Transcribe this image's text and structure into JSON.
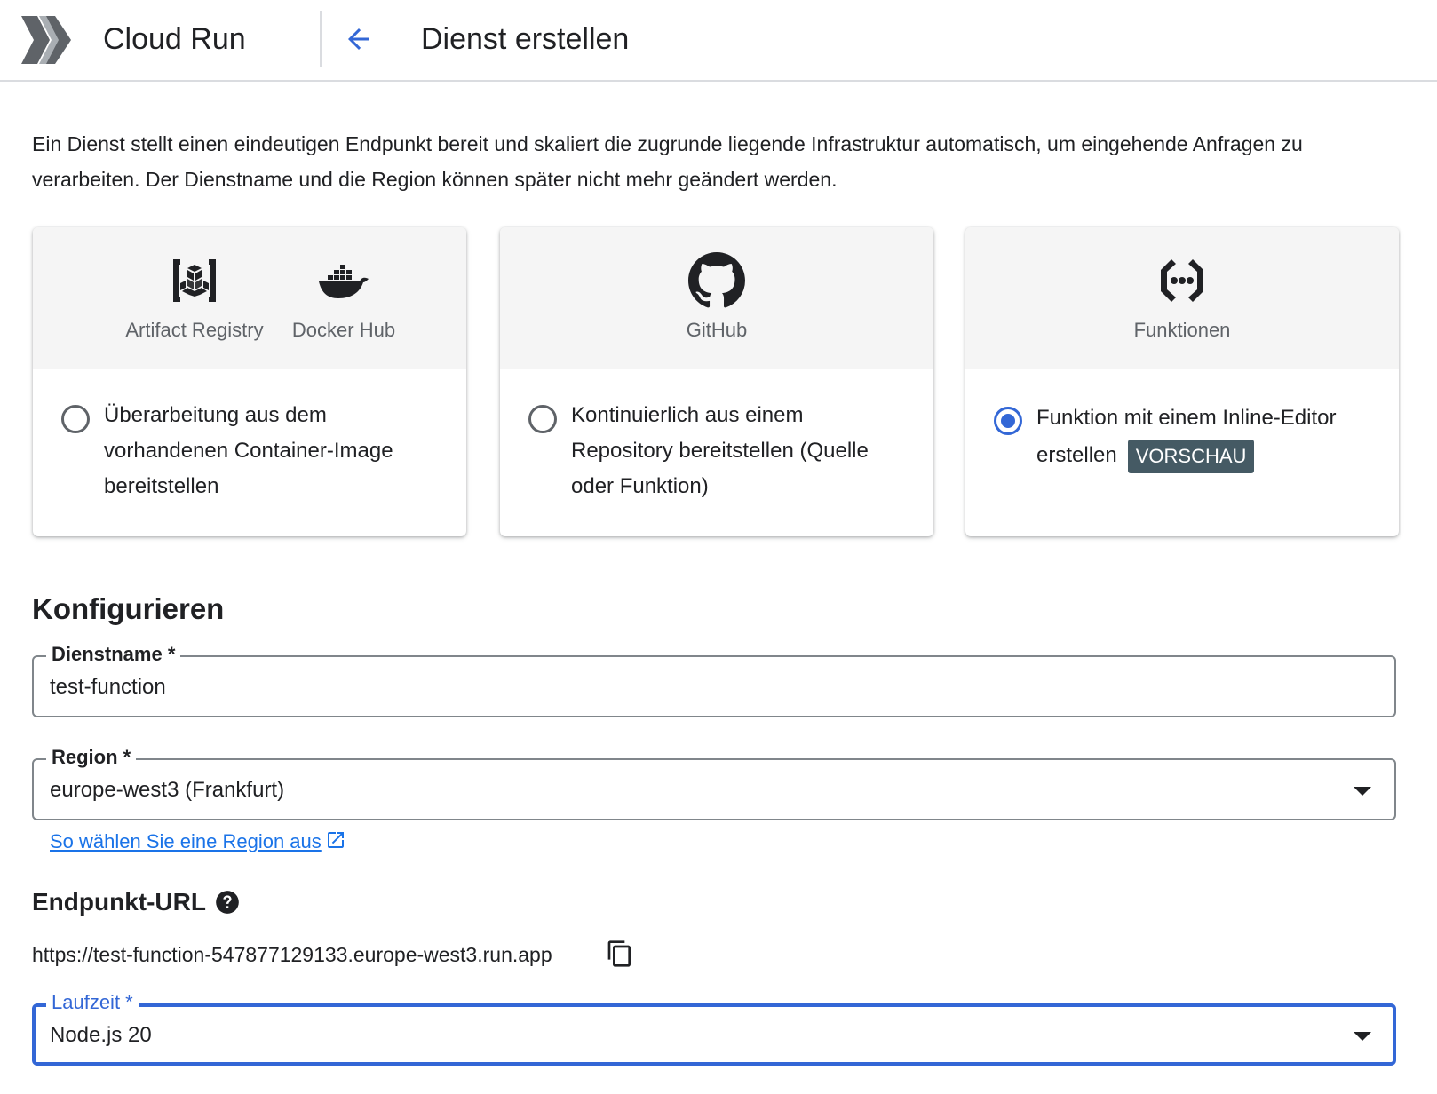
{
  "header": {
    "product_name": "Cloud Run",
    "page_title": "Dienst erstellen",
    "logo_icon": "cloud-run-logo",
    "back_icon": "arrow-back-icon"
  },
  "intro": {
    "text": "Ein Dienst stellt einen eindeutigen Endpunkt bereit und skaliert die zugrunde liegende Infrastruktur automatisch, um eingehende Anfragen zu verarbeiten. Der Dienstname und die Region können später nicht mehr geändert werden."
  },
  "deploy_options": [
    {
      "sources": [
        {
          "label": "Artifact Registry",
          "icon": "artifact-registry-icon"
        },
        {
          "label": "Docker Hub",
          "icon": "docker-icon"
        }
      ],
      "text": "Überarbeitung aus dem vorhandenen Container-Image bereitstellen",
      "selected": false
    },
    {
      "sources": [
        {
          "label": "GitHub",
          "icon": "github-icon"
        }
      ],
      "text": "Kontinuierlich aus einem Repository bereitstellen (Quelle oder Funktion)",
      "selected": false
    },
    {
      "sources": [
        {
          "label": "Funktionen",
          "icon": "functions-icon"
        }
      ],
      "text": "Funktion mit einem Inline-Editor erstellen",
      "badge": "VORSCHAU",
      "selected": true
    }
  ],
  "configure": {
    "title": "Konfigurieren",
    "service_name": {
      "label": "Dienstname *",
      "value": "test-function"
    },
    "region": {
      "label": "Region *",
      "value": "europe-west3 (Frankfurt)"
    },
    "region_help_link": "So wählen Sie eine Region aus",
    "endpoint": {
      "title": "Endpunkt-URL",
      "url": "https://test-function-547877129133.europe-west3.run.app"
    },
    "runtime": {
      "label": "Laufzeit *",
      "value": "Node.js 20"
    }
  },
  "colors": {
    "accent": "#3367d6",
    "link": "#1a73e8",
    "badge_bg": "#455a64",
    "card_header_bg": "#f5f5f5",
    "border": "#80868b"
  }
}
